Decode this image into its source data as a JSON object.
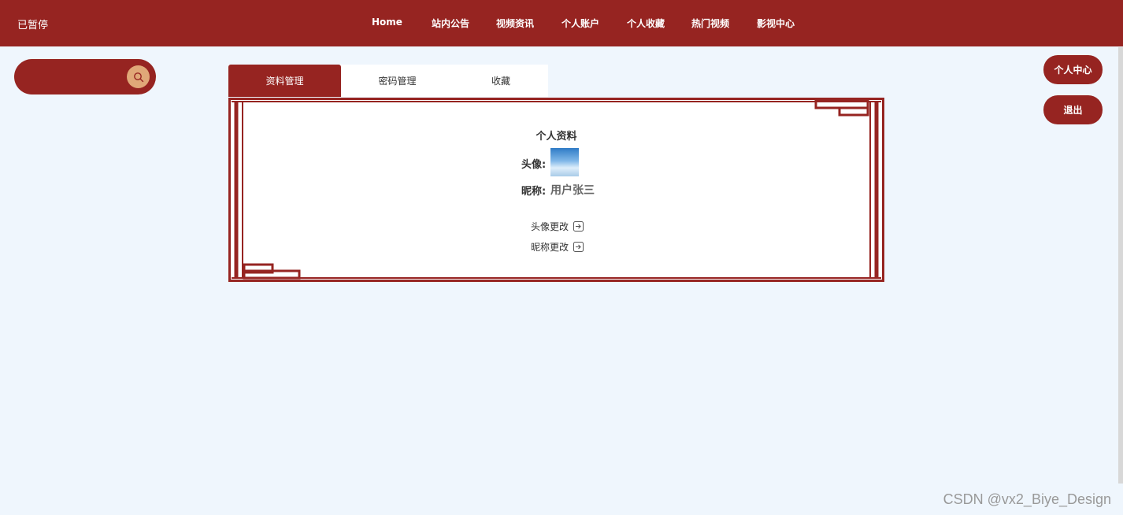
{
  "header": {
    "status_label": "已暂停",
    "nav": [
      "Home",
      "站内公告",
      "视频资讯",
      "个人账户",
      "个人收藏",
      "热门视频",
      "影视中心"
    ]
  },
  "search": {
    "placeholder": ""
  },
  "side_buttons": {
    "personal_center": "个人中心",
    "logout": "退出"
  },
  "tabs": [
    "资料管理",
    "密码管理",
    "收藏"
  ],
  "profile": {
    "title": "个人资料",
    "avatar_label": "头像:",
    "nickname_label": "昵称:",
    "nickname_value": "用户张三",
    "change_avatar": "头像更改",
    "change_nickname": "昵称更改"
  },
  "watermark": "CSDN @vx2_Biye_Design",
  "colors": {
    "primary": "#962421",
    "background": "#eff6fd",
    "search_button": "#e0a878"
  }
}
